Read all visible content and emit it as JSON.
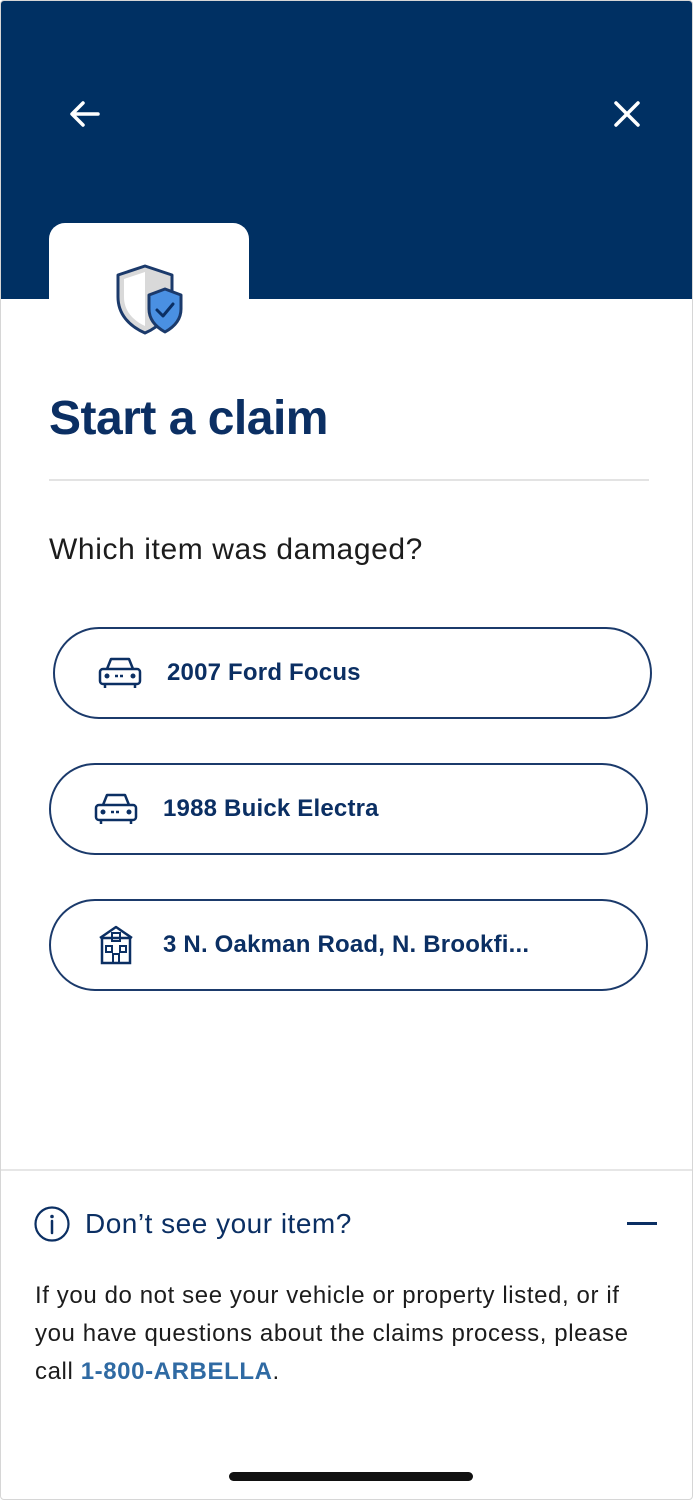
{
  "header": {
    "back_icon": "arrow-left-icon",
    "close_icon": "close-icon",
    "badge_icon": "shield-check-icon",
    "background_color": "#003063"
  },
  "page": {
    "title": "Start a claim",
    "question": "Which item was damaged?"
  },
  "items": [
    {
      "label": "2007 Ford Focus",
      "icon": "car-icon"
    },
    {
      "label": "1988 Buick Electra",
      "icon": "car-icon"
    },
    {
      "label": "3 N. Oakman Road, N. Brookfi...",
      "icon": "house-icon"
    }
  ],
  "help": {
    "title": "Don’t see your item?",
    "info_icon": "info-icon",
    "toggle_icon": "minus-icon",
    "body_text": "If you do not see your vehicle or property listed, or if you have questions about the claims process, please call ",
    "phone": "1-800-ARBELLA",
    "end_punct": "."
  },
  "colors": {
    "primary": "#0b2f63",
    "link": "#2f6aa3",
    "shield_blue": "#4a90e2"
  }
}
